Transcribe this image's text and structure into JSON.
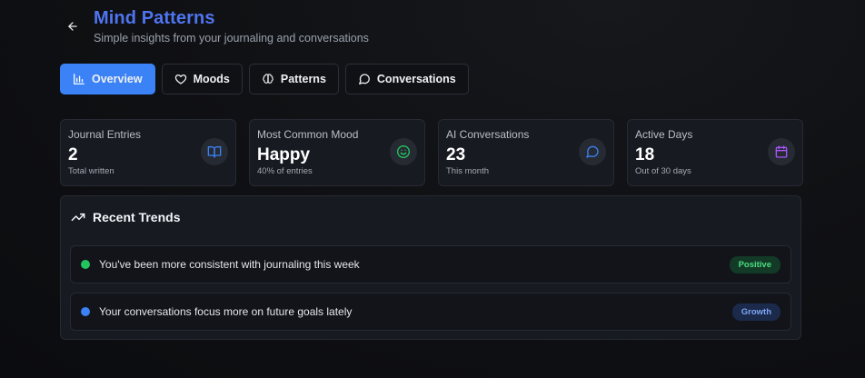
{
  "header": {
    "title": "Mind Patterns",
    "subtitle": "Simple insights from your journaling and conversations"
  },
  "tabs": [
    {
      "label": "Overview",
      "icon": "bar-chart-icon",
      "active": true
    },
    {
      "label": "Moods",
      "icon": "heart-icon",
      "active": false
    },
    {
      "label": "Patterns",
      "icon": "brain-icon",
      "active": false
    },
    {
      "label": "Conversations",
      "icon": "message-circle-icon",
      "active": false
    }
  ],
  "stats": [
    {
      "label": "Journal Entries",
      "value": "2",
      "sub": "Total written",
      "icon": "book-open-icon",
      "icon_color": "#3b82f6"
    },
    {
      "label": "Most Common Mood",
      "value": "Happy",
      "sub": "40% of entries",
      "icon": "smile-icon",
      "icon_color": "#22c55e"
    },
    {
      "label": "AI Conversations",
      "value": "23",
      "sub": "This month",
      "icon": "message-circle-icon",
      "icon_color": "#3b82f6"
    },
    {
      "label": "Active Days",
      "value": "18",
      "sub": "Out of 30 days",
      "icon": "calendar-icon",
      "icon_color": "#a855f7"
    }
  ],
  "trends": {
    "title": "Recent Trends",
    "items": [
      {
        "text": "You've been more consistent with journaling this week",
        "badge": "Positive",
        "dot_color": "#22c55e",
        "badge_bg": "#133a26",
        "badge_color": "#4ade80"
      },
      {
        "text": "Your conversations focus more on future goals lately",
        "badge": "Growth",
        "dot_color": "#3b82f6",
        "badge_bg": "#1b2a4a",
        "badge_color": "#7ea6f5"
      }
    ]
  },
  "colors": {
    "accent": "#3b82f6",
    "title": "#4f74f0",
    "background": "#0d0e11",
    "card": "#171a21"
  }
}
